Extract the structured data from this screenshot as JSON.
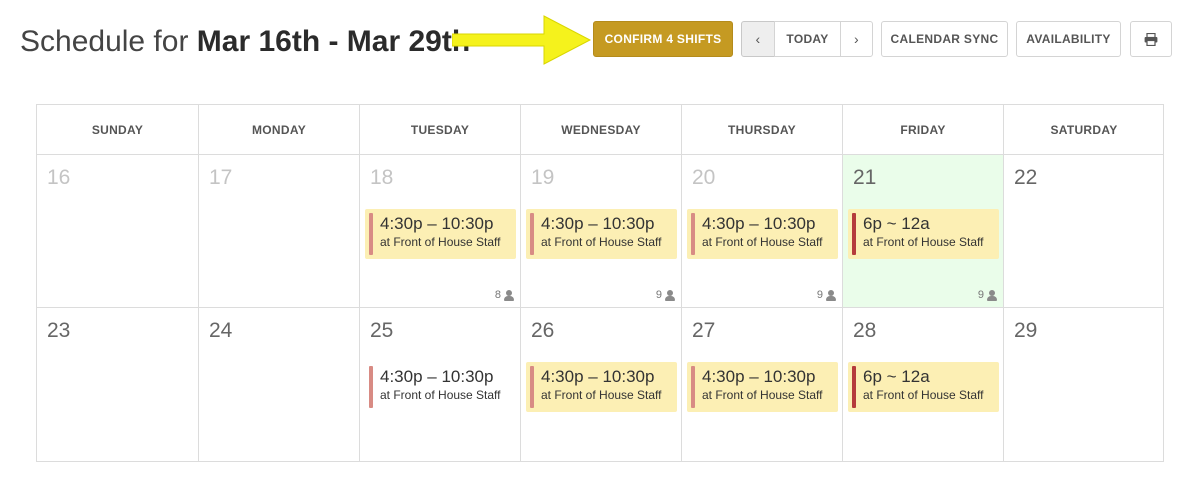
{
  "header": {
    "title_prefix": "Schedule for ",
    "title_range": "Mar 16th - Mar 29th"
  },
  "toolbar": {
    "confirm_label": "CONFIRM 4 SHIFTS",
    "prev_icon": "‹",
    "today_label": "TODAY",
    "next_icon": "›",
    "calendar_sync_label": "CALENDAR SYNC",
    "availability_label": "AVAILABILITY",
    "print_icon": "printer-icon"
  },
  "colors": {
    "accent": "#c59a22",
    "today_bg": "#eafdea",
    "shift_bg": "#fcefb4",
    "annotation_arrow": "#f5f21c"
  },
  "weekdays": [
    "SUNDAY",
    "MONDAY",
    "TUESDAY",
    "WEDNESDAY",
    "THURSDAY",
    "FRIDAY",
    "SATURDAY"
  ],
  "weeks": [
    {
      "days": [
        {
          "num": "16"
        },
        {
          "num": "17"
        },
        {
          "num": "18",
          "shift": {
            "time": "4:30p – 10:30p",
            "location": "at Front of House Staff"
          },
          "count": "8"
        },
        {
          "num": "19",
          "shift": {
            "time": "4:30p – 10:30p",
            "location": "at Front of House Staff"
          },
          "count": "9"
        },
        {
          "num": "20",
          "shift": {
            "time": "4:30p – 10:30p",
            "location": "at Front of House Staff"
          },
          "count": "9"
        },
        {
          "num": "21",
          "shift": {
            "time": "6p ~ 12a",
            "location": "at Front of House Staff"
          },
          "count": "9"
        },
        {
          "num": "22"
        }
      ]
    },
    {
      "days": [
        {
          "num": "23"
        },
        {
          "num": "24"
        },
        {
          "num": "25",
          "shift": {
            "time": "4:30p – 10:30p",
            "location": "at Front of House Staff"
          }
        },
        {
          "num": "26",
          "shift": {
            "time": "4:30p – 10:30p",
            "location": "at Front of House Staff"
          }
        },
        {
          "num": "27",
          "shift": {
            "time": "4:30p – 10:30p",
            "location": "at Front of House Staff"
          }
        },
        {
          "num": "28",
          "shift": {
            "time": "6p ~ 12a",
            "location": "at Front of House Staff"
          }
        },
        {
          "num": "29"
        }
      ]
    }
  ]
}
